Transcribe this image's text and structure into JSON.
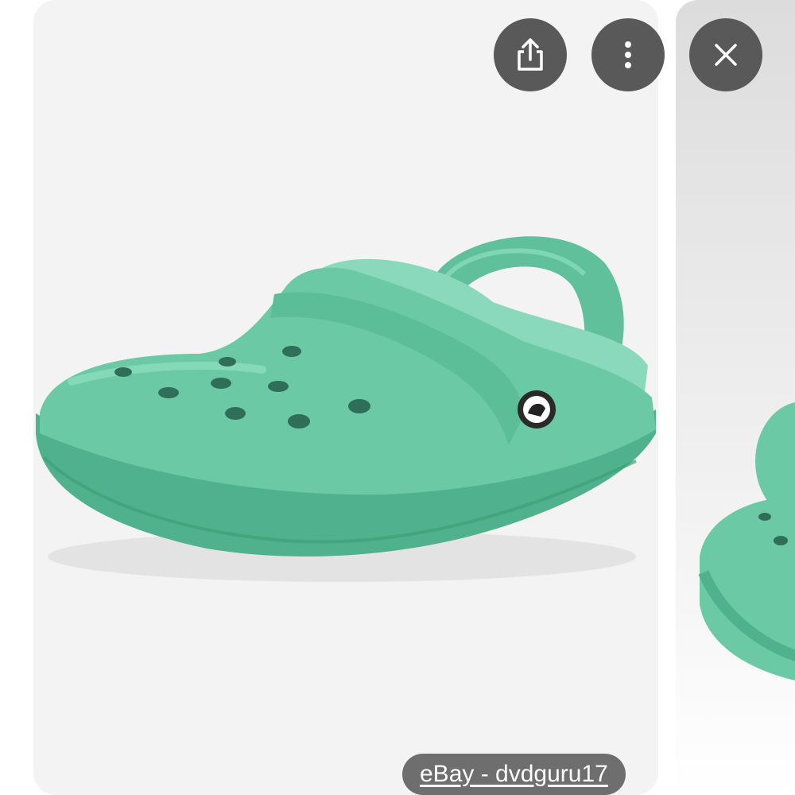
{
  "viewer": {
    "main_image": {
      "subject": "crocs-lined-clog-green",
      "accent": "#6cc9a5"
    },
    "next_image": {
      "subject": "green-clogs-pair"
    },
    "background": "#f3f3f3"
  },
  "toolbar": {
    "share_icon": "share-icon",
    "more_icon": "more-vert-icon",
    "close_icon": "close-icon",
    "button_color": "#595959"
  },
  "source": {
    "label": "eBay - dvdguru17"
  }
}
